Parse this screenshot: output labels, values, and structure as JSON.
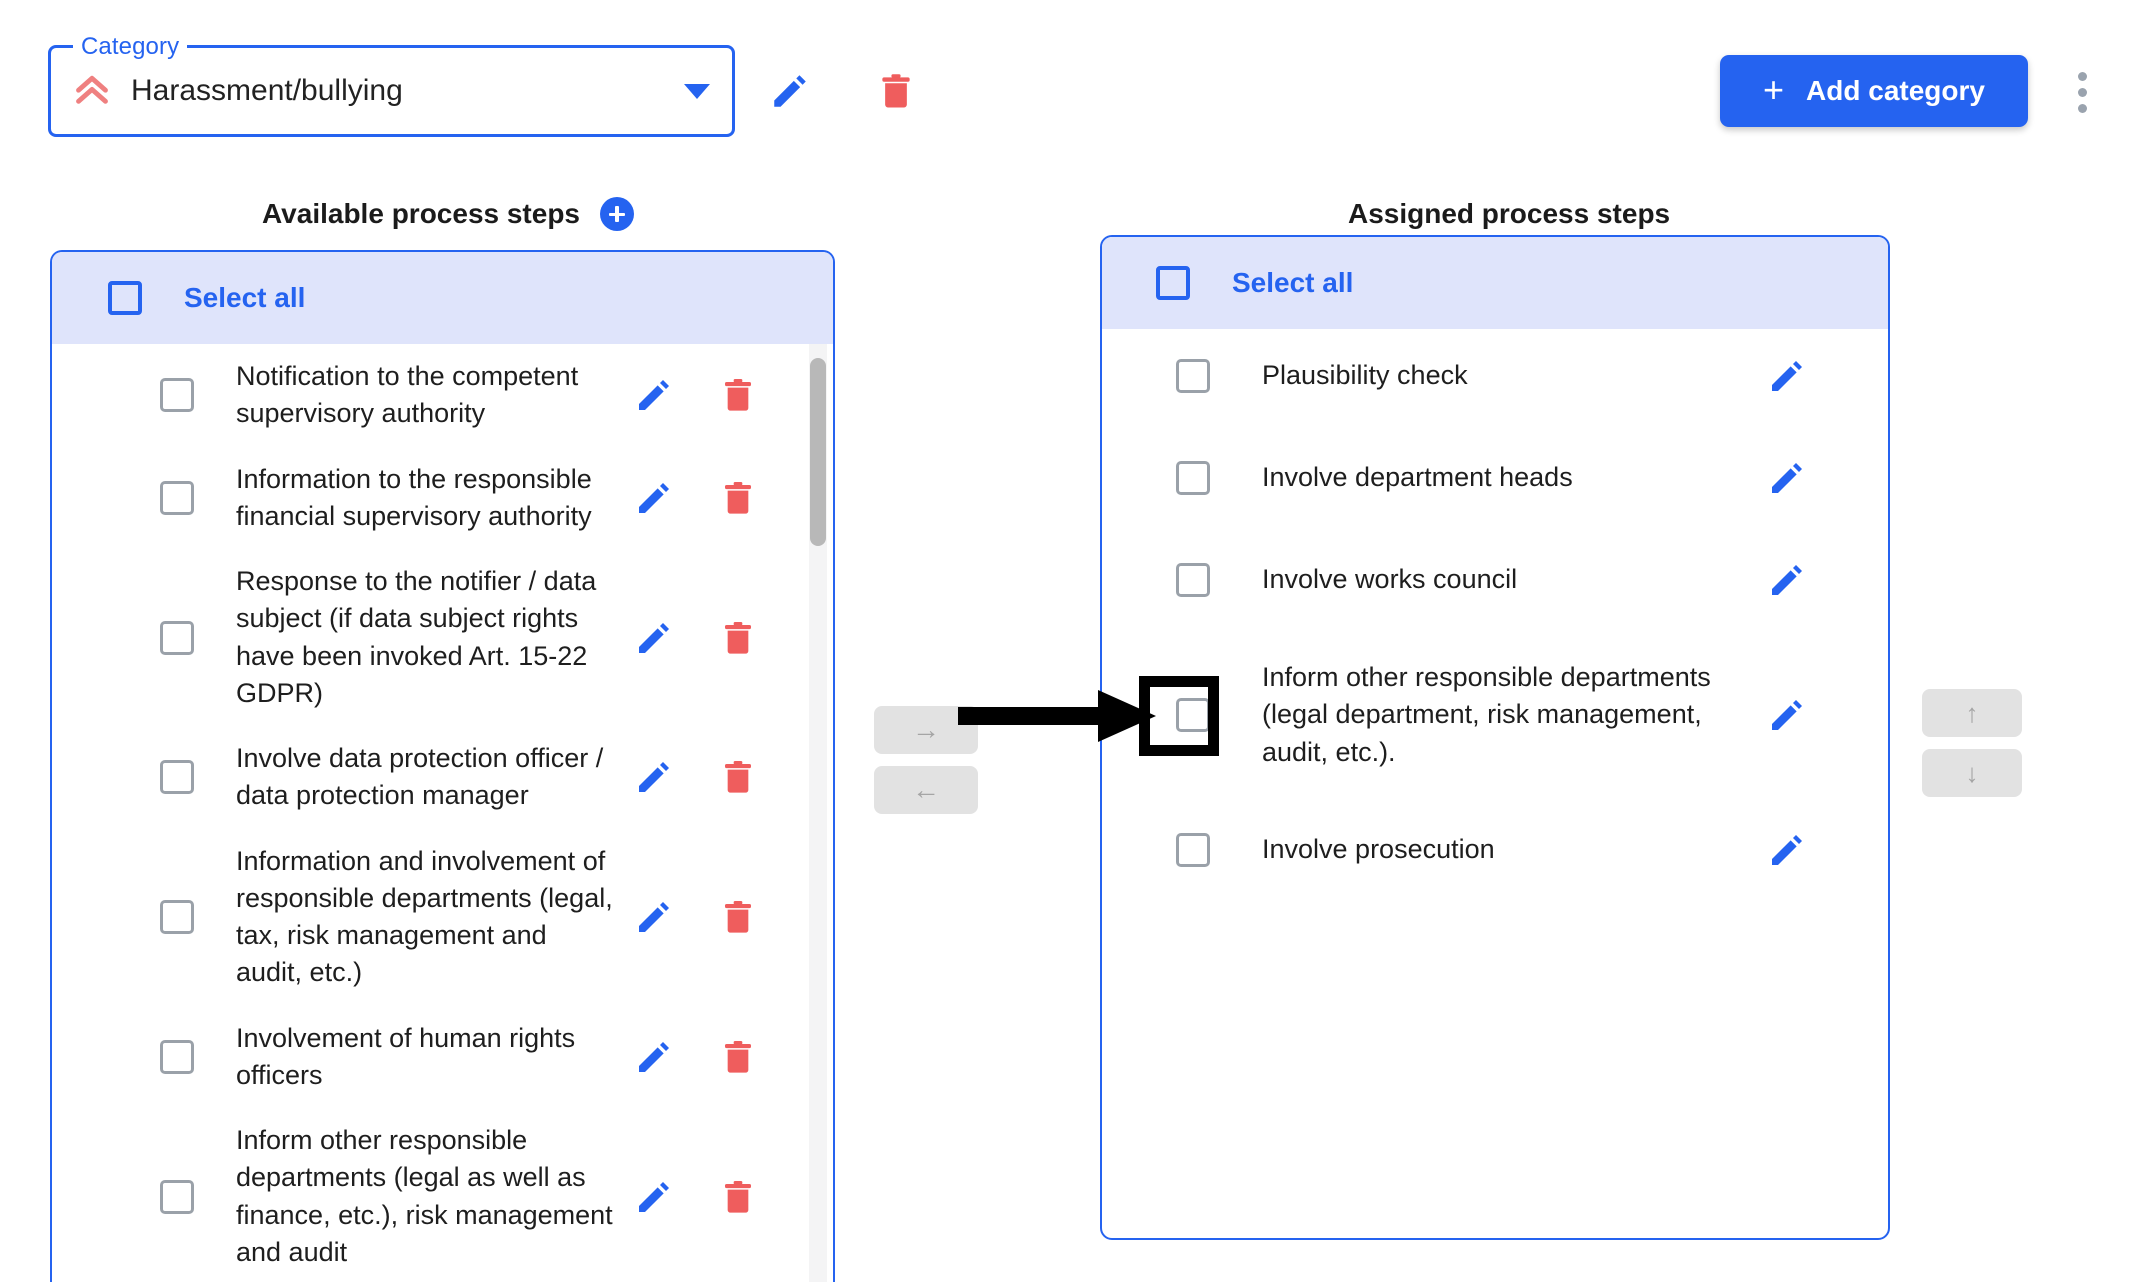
{
  "toolbar": {
    "category_legend": "Category",
    "category_value": "Harassment/bullying",
    "severity_icon": "double-chevron-up-icon",
    "caret_icon": "chevron-down-icon",
    "edit_icon": "pencil-icon",
    "delete_icon": "trash-icon",
    "add_category_label": "Add category",
    "add_category_plus": "+",
    "add_category_color": "#2563f0",
    "kebab_icon": "more-vertical-icon"
  },
  "columns": {
    "left": {
      "title": "Available process steps",
      "add_icon": "plus-circle-icon",
      "select_all_label": "Select all",
      "items": [
        {
          "label": "Notification to the competent supervisory authority",
          "checked": false
        },
        {
          "label": "Information to the responsible financial supervisory authority",
          "checked": false
        },
        {
          "label": "Response to the notifier / data subject (if data subject rights have been invoked Art. 15-22 GDPR)",
          "checked": false
        },
        {
          "label": "Involve data protection officer / data protection manager",
          "checked": false
        },
        {
          "label": "Information and involvement of responsible departments (legal, tax, risk management and audit, etc.)",
          "checked": false
        },
        {
          "label": "Involvement of human rights officers",
          "checked": false
        },
        {
          "label": "Inform other responsible departments (legal as well as finance, etc.), risk management and audit",
          "checked": false
        }
      ]
    },
    "right": {
      "title": "Assigned process steps",
      "select_all_label": "Select all",
      "items": [
        {
          "label": "Plausibility check",
          "checked": false
        },
        {
          "label": "Involve department heads",
          "checked": false
        },
        {
          "label": "Involve works council",
          "checked": false
        },
        {
          "label": "Inform other responsible departments (legal department, risk management, audit, etc.).",
          "checked": false
        },
        {
          "label": "Involve prosecution",
          "checked": false
        }
      ]
    }
  },
  "transfer": {
    "assign_label": "→",
    "unassign_label": "←",
    "move_up_label": "↑",
    "move_down_label": "↓"
  },
  "annotation": {
    "target_item_index": 3,
    "arrow_color": "#000000",
    "box_color": "#000000"
  },
  "colors": {
    "accent": "#2563f0",
    "header_bg": "#dfe4fb",
    "danger": "#ef5d5d",
    "disabled_bg": "#e2e2e2"
  }
}
